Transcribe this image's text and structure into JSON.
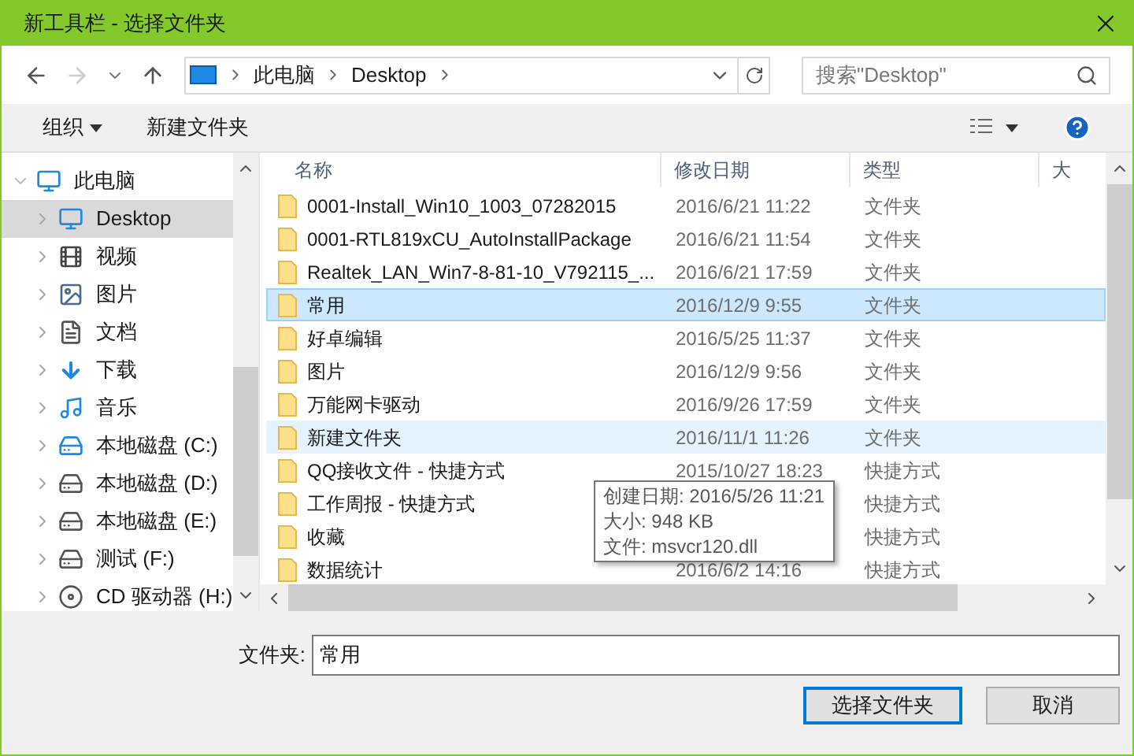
{
  "window": {
    "title": "新工具栏 - 选择文件夹"
  },
  "address": {
    "crumbs": [
      "此电脑",
      "Desktop"
    ],
    "search_placeholder": "搜索\"Desktop\""
  },
  "toolbar": {
    "organize": "组织",
    "new_folder": "新建文件夹"
  },
  "sidebar": {
    "items": [
      {
        "label": "此电脑",
        "kind": "pc",
        "expanded": true,
        "selected": false,
        "children": [
          {
            "label": "Desktop",
            "kind": "desktop",
            "selected": true
          },
          {
            "label": "视频",
            "kind": "video",
            "selected": false
          },
          {
            "label": "图片",
            "kind": "picture",
            "selected": false
          },
          {
            "label": "文档",
            "kind": "document",
            "selected": false
          },
          {
            "label": "下载",
            "kind": "download",
            "selected": false
          },
          {
            "label": "音乐",
            "kind": "music",
            "selected": false
          },
          {
            "label": "本地磁盘 (C:)",
            "kind": "system-drive",
            "selected": false
          },
          {
            "label": "本地磁盘 (D:)",
            "kind": "drive",
            "selected": false
          },
          {
            "label": "本地磁盘 (E:)",
            "kind": "drive",
            "selected": false
          },
          {
            "label": "测试 (F:)",
            "kind": "drive",
            "selected": false
          },
          {
            "label": "CD 驱动器 (H:)",
            "kind": "cd",
            "selected": false
          }
        ]
      }
    ]
  },
  "table": {
    "columns": [
      "名称",
      "修改日期",
      "类型",
      "大"
    ],
    "rows": [
      {
        "name": "0001-Install_Win10_1003_07282015",
        "date": "2016/6/21 11:22",
        "type": "文件夹",
        "selected": false,
        "hovered": false
      },
      {
        "name": "0001-RTL819xCU_AutoInstallPackage",
        "date": "2016/6/21 11:54",
        "type": "文件夹",
        "selected": false,
        "hovered": false
      },
      {
        "name": "Realtek_LAN_Win7-8-81-10_V792115_...",
        "date": "2016/6/21 17:59",
        "type": "文件夹",
        "selected": false,
        "hovered": false
      },
      {
        "name": "常用",
        "date": "2016/12/9 9:55",
        "type": "文件夹",
        "selected": true,
        "hovered": false
      },
      {
        "name": "好卓编辑",
        "date": "2016/5/25 11:37",
        "type": "文件夹",
        "selected": false,
        "hovered": false
      },
      {
        "name": "图片",
        "date": "2016/12/9 9:56",
        "type": "文件夹",
        "selected": false,
        "hovered": false
      },
      {
        "name": "万能网卡驱动",
        "date": "2016/9/26 17:59",
        "type": "文件夹",
        "selected": false,
        "hovered": false
      },
      {
        "name": "新建文件夹",
        "date": "2016/11/1 11:26",
        "type": "文件夹",
        "selected": false,
        "hovered": true
      },
      {
        "name": "QQ接收文件 - 快捷方式",
        "date": "2015/10/27 18:23",
        "type": "快捷方式",
        "selected": false,
        "hovered": false
      },
      {
        "name": "工作周报 - 快捷方式",
        "type": "快捷方式",
        "selected": false,
        "hovered": false
      },
      {
        "name": "收藏",
        "type": "快捷方式",
        "selected": false,
        "hovered": false
      },
      {
        "name": "数据统计",
        "date": "2016/6/2 14:16",
        "type": "快捷方式",
        "selected": false,
        "hovered": false
      }
    ]
  },
  "tooltip": {
    "lines": [
      "创建日期: 2016/5/26 11:21",
      "大小: 948 KB",
      "文件: msvcr120.dll"
    ]
  },
  "folder_field": {
    "label": "文件夹:",
    "value": "常用"
  },
  "buttons": [
    {
      "label": "选择文件夹",
      "default": true
    },
    {
      "label": "取消",
      "default": false
    }
  ]
}
